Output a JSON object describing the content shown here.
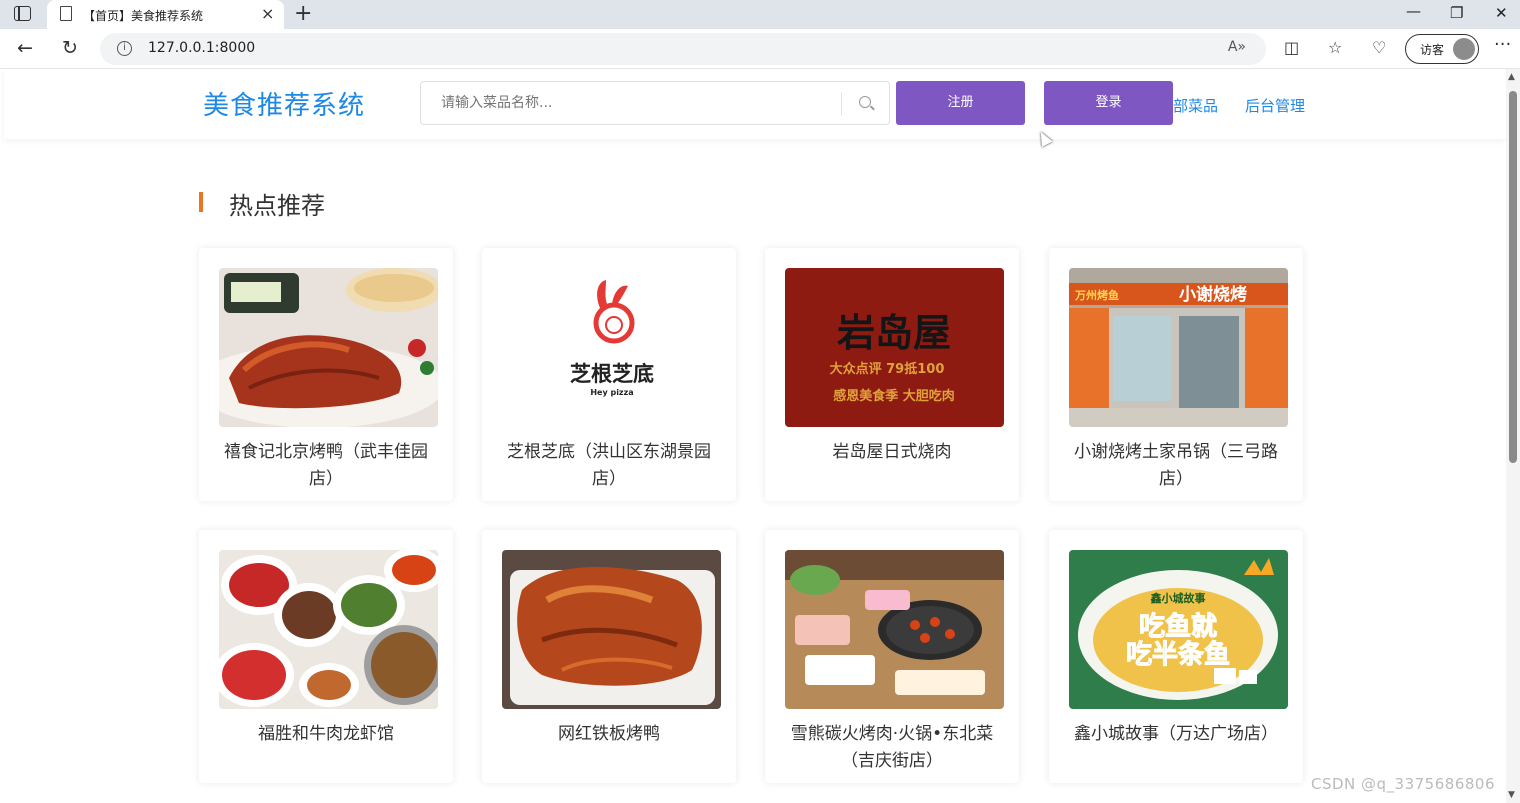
{
  "browser": {
    "tab_title": "【首页】美食推荐系统",
    "close_glyph": "×",
    "new_tab_glyph": "+",
    "url": "127.0.0.1:8000",
    "profile_label": "访客",
    "more_glyph": "···"
  },
  "header": {
    "logo": "美食推荐系统",
    "search_placeholder": "请输入菜品名称...",
    "register_label": "注册",
    "login_label": "登录",
    "nav_all_dishes": "全部菜品",
    "nav_admin": "后台管理"
  },
  "section": {
    "title": "热点推荐"
  },
  "cards": [
    {
      "name": "禧食记北京烤鸭（武丰佳园店）",
      "image": "roast-duck-photo"
    },
    {
      "name": "芝根芝底（洪山区东湖景园店）",
      "image": "hey-pizza-logo"
    },
    {
      "name": "岩岛屋日式烧肉",
      "image": "yandaowu-sign"
    },
    {
      "name": "小谢烧烤土家吊锅（三弓路店）",
      "image": "storefront-photo"
    },
    {
      "name": "福胜和牛肉龙虾馆",
      "image": "dishes-photo"
    },
    {
      "name": "网红铁板烤鸭",
      "image": "roast-duck-plate-photo"
    },
    {
      "name": "雪熊碳火烤肉·火锅•东北菜（吉庆街店）",
      "image": "bbq-table-photo"
    },
    {
      "name": "鑫小城故事（万达广场店）",
      "image": "fish-bowl-poster"
    }
  ],
  "logos": {
    "pizza_cn": "芝根芝底",
    "pizza_en": "Hey pizza",
    "yandaowu_big": "岩岛屋",
    "yandaowu_line1": "大众点评 79抵100",
    "yandaowu_line2": "感恩美食季 大胆吃肉",
    "store_sign_left": "万州烤鱼",
    "store_sign_right": "小谢烧烤",
    "fish_line1": "吃鱼就",
    "fish_line2": "吃半条鱼",
    "fish_brand": "鑫小城故事"
  },
  "watermark": "CSDN @q_3375686806",
  "colors": {
    "accent_purple": "#7e57c2",
    "link_blue": "#1e88e5",
    "section_bar_orange": "#e87722"
  }
}
